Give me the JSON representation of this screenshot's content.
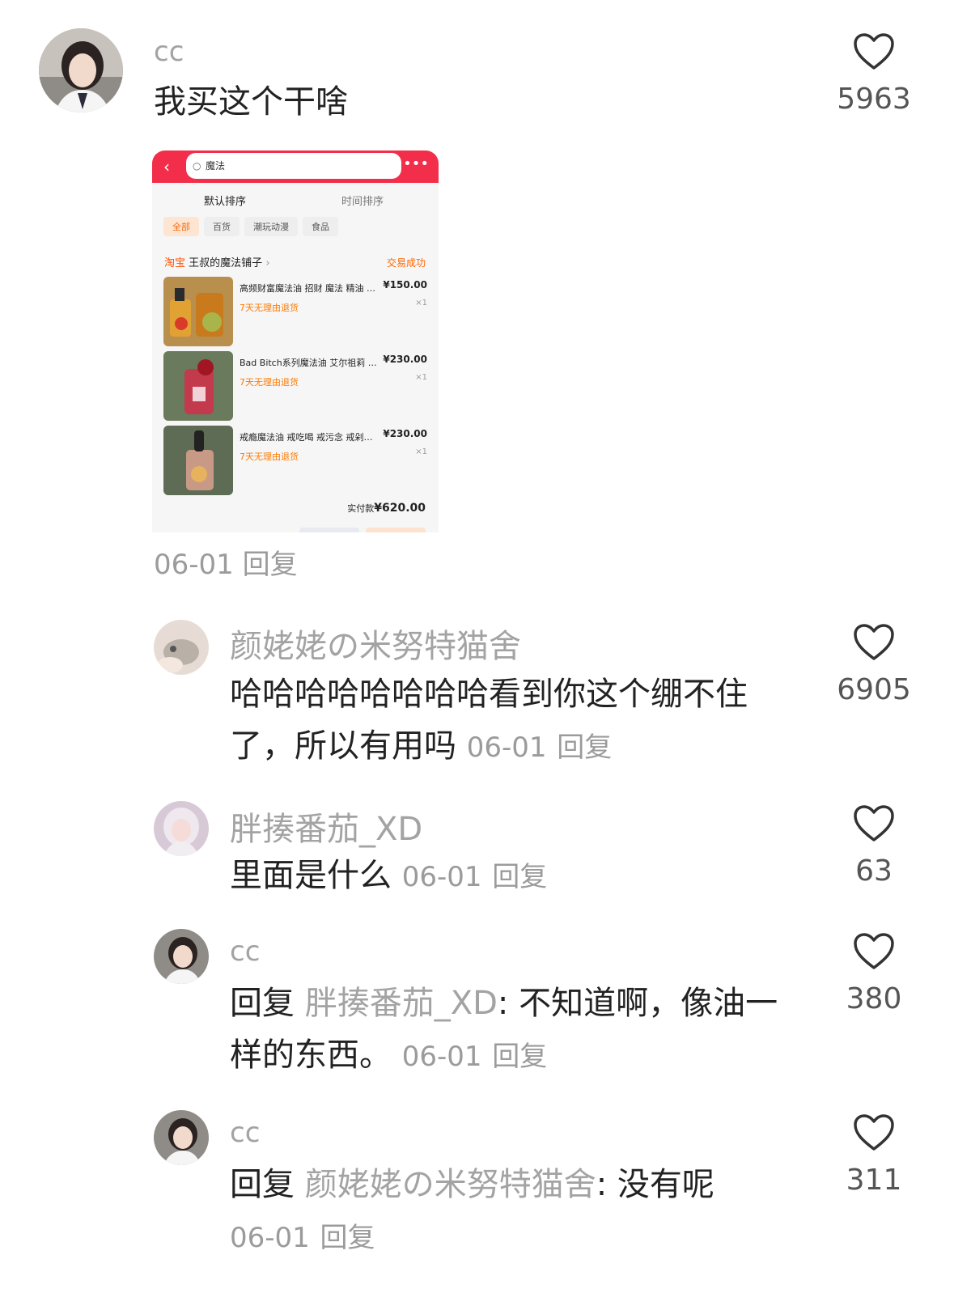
{
  "colors": {
    "username": "#a3a3a3",
    "meta": "#9b9b9b",
    "text": "#222222",
    "taobao_red": "#f22e4a",
    "taobao_orange": "#ff6600"
  },
  "comments": [
    {
      "username": "cc",
      "text": "我买这个干啥",
      "date": "06-01",
      "reply_label": "回复",
      "likes": "5963"
    },
    {
      "username": "颜姥姥の米努特猫舍",
      "text_line1": "哈哈哈哈哈哈哈哈看到你这个绷不住",
      "text_line2": "了，所以有用吗",
      "date": "06-01",
      "reply_label": "回复",
      "likes": "6905"
    },
    {
      "username": "胖揍番茄_XD",
      "text": "里面是什么",
      "date": "06-01",
      "reply_label": "回复",
      "likes": "63"
    },
    {
      "username": "cc",
      "reply_prefix": "回复",
      "mention": "胖揍番茄_XD",
      "text_line1": ": 不知道啊，像油一",
      "text_line2": "样的东西。",
      "date": "06-01",
      "reply_label": "回复",
      "likes": "380"
    },
    {
      "username": "cc",
      "reply_prefix": "回复",
      "mention": "颜姥姥の米努特猫舍",
      "text_line1": ": 没有呢",
      "date": "06-01",
      "reply_label": "回复",
      "likes": "311"
    }
  ],
  "order_screenshot": {
    "search_text": "魔法",
    "sort_default": "默认排序",
    "sort_time": "时间排序",
    "chips": [
      "全部",
      "百货",
      "潮玩动漫",
      "食品"
    ],
    "shop_prefix": "淘宝",
    "shop_name": "王叔的魔法铺子",
    "status": "交易成功",
    "items": [
      {
        "title": "高频财富魔法油 招财 魔法 精油 …",
        "price": "¥150.00",
        "qty": "×1",
        "tag": "7天无理由退货",
        "icon": "oil-bottles-photo"
      },
      {
        "title": "Bad Bitch系列魔法油 艾尔祖莉 …",
        "price": "¥230.00",
        "qty": "×1",
        "tag": "7天无理由退货",
        "icon": "red-bottle-photo"
      },
      {
        "title": "戒瘾魔法油 戒吃喝 戒污念 戒剁…",
        "price": "¥230.00",
        "qty": "×1",
        "tag": "7天无理由退货",
        "icon": "dropper-bottle-photo"
      }
    ],
    "total_label": "实付款",
    "total_value": "¥620.00"
  }
}
